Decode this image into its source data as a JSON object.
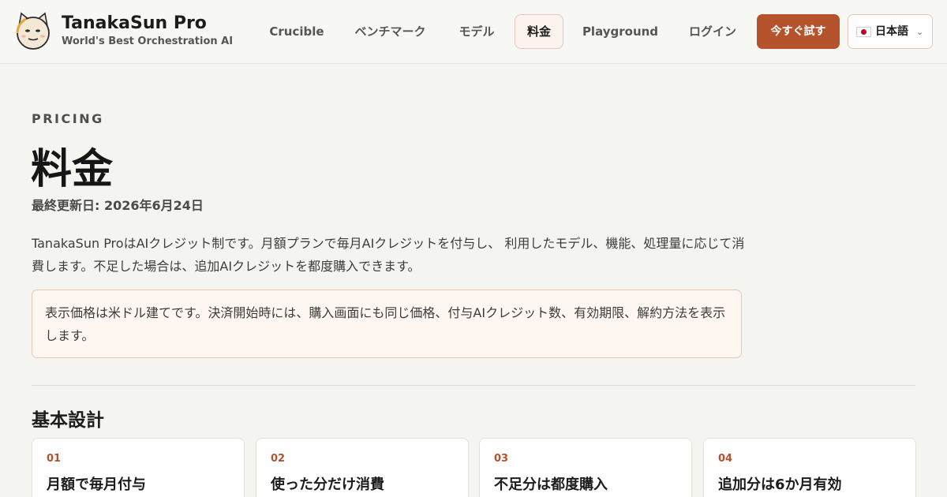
{
  "header": {
    "brand_name": "TanakaSun Pro",
    "brand_tagline": "World's Best Orchestration AI",
    "logo_icon": "cartoon-face-logo-icon",
    "nav": [
      {
        "label": "Crucible",
        "active": false
      },
      {
        "label": "ベンチマーク",
        "active": false
      },
      {
        "label": "モデル",
        "active": false
      },
      {
        "label": "料金",
        "active": true
      },
      {
        "label": "Playground",
        "active": false
      },
      {
        "label": "ログイン",
        "active": false
      }
    ],
    "cta_label": "今すぐ試す",
    "language": {
      "label": "日本語",
      "flag_icon": "japan-flag-icon",
      "chevron_icon": "chevron-down-icon"
    }
  },
  "main": {
    "eyebrow": "PRICING",
    "title": "料金",
    "updated": "最終更新日: 2026年6月24日",
    "intro": "TanakaSun ProはAIクレジット制です。月額プランで毎月AIクレジットを付与し、 利用したモデル、機能、処理量に応じて消費します。不足した場合は、追加AIクレジットを都度購入できます。",
    "notice": "表示価格は米ドル建てです。決済開始時には、購入画面にも同じ価格、付与AIクレジット数、有効期限、解約方法を表示します。",
    "section_heading": "基本設計",
    "cards": [
      {
        "num": "01",
        "title": "月額で毎月付与"
      },
      {
        "num": "02",
        "title": "使った分だけ消費"
      },
      {
        "num": "03",
        "title": "不足分は都度購入"
      },
      {
        "num": "04",
        "title": "追加分は6か月有効"
      }
    ]
  },
  "colors": {
    "accent": "#b4532c",
    "background": "#f4f4f1",
    "notice_bg": "#fdf6f1",
    "notice_border": "#e8c6b4"
  }
}
